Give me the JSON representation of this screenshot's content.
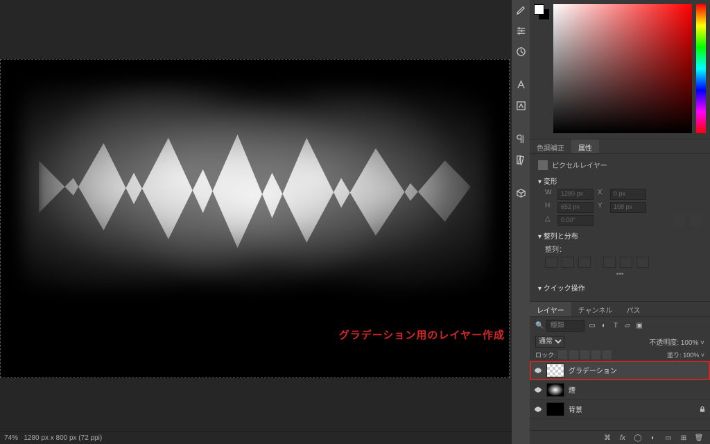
{
  "statusbar": {
    "zoom": "74%",
    "doc_info": "1280 px x 800 px (72 ppi)"
  },
  "properties": {
    "tab_color_adjust": "色調補正",
    "tab_properties": "属性",
    "layer_type": "ピクセルレイヤー",
    "transform_label": "変形",
    "w_label": "W",
    "w_value": "1280 px",
    "x_label": "X",
    "x_value": "0 px",
    "h_label": "H",
    "h_value": "652 px",
    "y_label": "Y",
    "y_value": "108 px",
    "angle": "0.00°",
    "align_label": "整列と分布",
    "align_sub": "整列：",
    "quick_label": "クイック操作"
  },
  "layers_panel": {
    "tab_layers": "レイヤー",
    "tab_channels": "チャンネル",
    "tab_paths": "パス",
    "search_placeholder": "種類",
    "blend_mode": "通常",
    "opacity_label": "不透明度:",
    "opacity_value": "100%",
    "lock_label": "ロック:",
    "fill_label": "塗り:",
    "fill_value": "100%",
    "items": [
      {
        "name": "グラデーション"
      },
      {
        "name": "煙"
      },
      {
        "name": "背景"
      }
    ]
  },
  "annotation": "グラデーション用のレイヤー作成"
}
